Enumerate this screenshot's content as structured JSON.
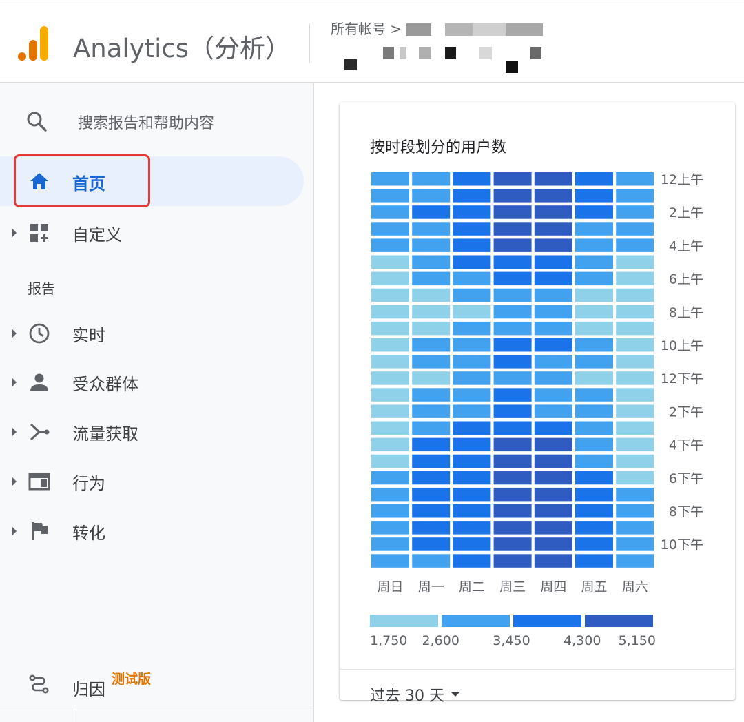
{
  "header": {
    "product_name": "Analytics（分析）",
    "account_label": "所有帐号 >",
    "logo_icon": "analytics-bar-logo",
    "logo_colors": [
      "#f9ab00",
      "#e37400"
    ]
  },
  "sidebar": {
    "search_placeholder": "搜索报告和帮助内容",
    "home_label": "首页",
    "customize_label": "自定义",
    "reports_heading": "报告",
    "items": [
      {
        "label": "实时",
        "icon": "clock-icon"
      },
      {
        "label": "受众群体",
        "icon": "person-icon"
      },
      {
        "label": "流量获取",
        "icon": "acquisition-icon"
      },
      {
        "label": "行为",
        "icon": "behavior-icon"
      },
      {
        "label": "转化",
        "icon": "flag-icon"
      }
    ],
    "attribution_label": "归因",
    "attribution_badge": "测试版",
    "accent_color": "#1967d2"
  },
  "card": {
    "title": "按时段划分的用户数",
    "date_range": "过去 30 天"
  },
  "chart_data": {
    "type": "heatmap",
    "title": "按时段划分的用户数",
    "x_categories": [
      "周日",
      "周一",
      "周二",
      "周三",
      "周四",
      "周五",
      "周六"
    ],
    "y_categories": [
      "12上午",
      "1上午",
      "2上午",
      "3上午",
      "4上午",
      "5上午",
      "6上午",
      "7上午",
      "8上午",
      "9上午",
      "10上午",
      "11上午",
      "12下午",
      "1下午",
      "2下午",
      "3下午",
      "4下午",
      "5下午",
      "6下午",
      "7下午",
      "8下午",
      "9下午",
      "10下午",
      "11下午"
    ],
    "y_tick_labels": [
      "12上午",
      "2上午",
      "4上午",
      "6上午",
      "8上午",
      "10上午",
      "12下午",
      "2下午",
      "4下午",
      "6下午",
      "8下午",
      "10下午"
    ],
    "legend_labels": [
      "1,750",
      "2,600",
      "3,450",
      "4,300",
      "5,150"
    ],
    "legend_bins": [
      1750,
      2600,
      3450,
      4300,
      5150
    ],
    "color_scale": [
      "#90d1ea",
      "#42a2f0",
      "#1a73e8",
      "#2f5cc0"
    ],
    "values": [
      [
        2800,
        2800,
        3800,
        4600,
        4700,
        4000,
        2800
      ],
      [
        2800,
        2800,
        3800,
        4600,
        4700,
        3800,
        2800
      ],
      [
        2800,
        3800,
        3800,
        4600,
        4700,
        3800,
        2800
      ],
      [
        2800,
        2800,
        3800,
        4600,
        4700,
        2800,
        2800
      ],
      [
        2800,
        2800,
        3800,
        4600,
        4700,
        2800,
        2800
      ],
      [
        2000,
        2800,
        3800,
        3800,
        3800,
        2800,
        2000
      ],
      [
        2000,
        2800,
        2800,
        3800,
        3800,
        2800,
        2000
      ],
      [
        2000,
        2000,
        2800,
        2800,
        2800,
        2000,
        2000
      ],
      [
        2000,
        2000,
        2000,
        2800,
        2800,
        2000,
        2000
      ],
      [
        2000,
        2000,
        2800,
        2800,
        2800,
        2000,
        2000
      ],
      [
        2000,
        2800,
        2800,
        3800,
        3800,
        2800,
        2000
      ],
      [
        2000,
        2800,
        2800,
        3800,
        2800,
        2800,
        2000
      ],
      [
        2000,
        2000,
        2800,
        2800,
        2800,
        2000,
        2000
      ],
      [
        2000,
        2800,
        2800,
        3800,
        2800,
        2800,
        2000
      ],
      [
        2000,
        2800,
        2800,
        3800,
        2800,
        2800,
        2000
      ],
      [
        2000,
        2800,
        3800,
        3800,
        3800,
        2800,
        2000
      ],
      [
        2000,
        3800,
        3800,
        4600,
        4600,
        2800,
        2000
      ],
      [
        2000,
        3800,
        3800,
        4600,
        4600,
        2800,
        2000
      ],
      [
        2800,
        3800,
        3800,
        4600,
        4600,
        3800,
        2000
      ],
      [
        2800,
        3800,
        3800,
        4600,
        4600,
        3800,
        2800
      ],
      [
        2800,
        3800,
        3800,
        4600,
        4600,
        3800,
        2800
      ],
      [
        2800,
        3800,
        3800,
        4600,
        4600,
        3800,
        2800
      ],
      [
        2800,
        3800,
        3800,
        4600,
        4600,
        3800,
        2800
      ],
      [
        2800,
        2800,
        3800,
        4600,
        4600,
        3800,
        2800
      ]
    ]
  }
}
